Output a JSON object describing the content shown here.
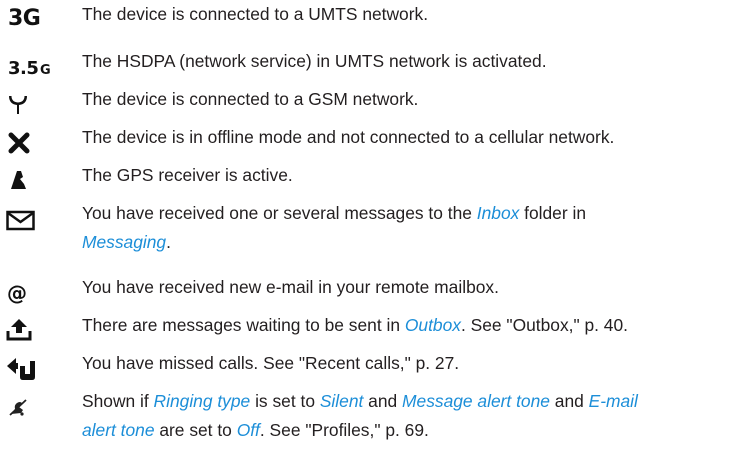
{
  "items": [
    {
      "icon": "3g-icon",
      "icon_text": "3G",
      "line1": [
        "The device is connected to a UMTS network."
      ]
    },
    {
      "icon": "3-5g-icon",
      "icon_text_main": "3.5",
      "icon_text_sub": "G",
      "line1": [
        "The HSDPA (network service) in UMTS network is activated."
      ]
    },
    {
      "icon": "gsm-antenna-icon",
      "line1": [
        "The device is connected to a GSM network."
      ]
    },
    {
      "icon": "offline-x-icon",
      "line1": [
        "The device is in offline mode and not connected to a cellular network."
      ]
    },
    {
      "icon": "gps-receiver-icon",
      "line1": [
        "The GPS receiver is active."
      ]
    },
    {
      "icon": "envelope-icon",
      "line1": [
        "You have received one or several messages to the ",
        "Inbox",
        " folder in"
      ],
      "line2": [
        "Messaging",
        "."
      ]
    },
    {
      "icon": "at-sign-icon",
      "icon_text": "@",
      "line1": [
        "You have received new e-mail in your remote mailbox."
      ]
    },
    {
      "icon": "outbox-upload-icon",
      "line1": [
        "There are messages waiting to be sent in ",
        "Outbox",
        ". See \"Outbox,\" p. 40."
      ]
    },
    {
      "icon": "missed-call-arrow-icon",
      "line1": [
        "You have missed calls. See \"Recent calls,\" p. 27."
      ]
    },
    {
      "icon": "silent-bell-icon",
      "line1": [
        "Shown if ",
        "Ringing type",
        " is set to ",
        "Silent",
        " and ",
        "Message alert tone",
        " and ",
        "E-mail"
      ],
      "line2": [
        "alert tone",
        " are set to ",
        "Off",
        ". See \"Profiles,\" p. 69."
      ]
    }
  ],
  "colors": {
    "text": "#231f20",
    "link": "#1c8ed8",
    "icon": "#111111"
  }
}
